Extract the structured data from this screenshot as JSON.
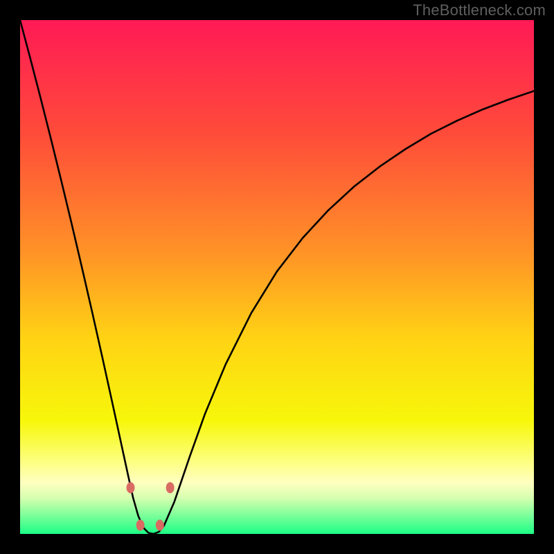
{
  "watermark": "TheBottleneck.com",
  "chart_data": {
    "type": "line",
    "title": "",
    "xlabel": "",
    "ylabel": "",
    "xlim": [
      0,
      100
    ],
    "ylim": [
      0,
      100
    ],
    "grid": false,
    "legend": false,
    "background": {
      "type": "vertical-gradient",
      "stops": [
        {
          "pct": 0,
          "color": "#ff1a55"
        },
        {
          "pct": 22,
          "color": "#ff4b3a"
        },
        {
          "pct": 45,
          "color": "#ff9227"
        },
        {
          "pct": 62,
          "color": "#ffd314"
        },
        {
          "pct": 78,
          "color": "#f7f70a"
        },
        {
          "pct": 86,
          "color": "#fdff82"
        },
        {
          "pct": 90,
          "color": "#ffffc0"
        },
        {
          "pct": 93,
          "color": "#d6ffb0"
        },
        {
          "pct": 96,
          "color": "#86ff9c"
        },
        {
          "pct": 100,
          "color": "#1cff86"
        }
      ]
    },
    "series": [
      {
        "name": "bottleneck-curve",
        "x": [
          0.0,
          2.0,
          4.0,
          6.0,
          8.0,
          10.0,
          12.0,
          14.0,
          16.0,
          18.0,
          19.0,
          20.0,
          21.0,
          22.0,
          23.0,
          24.0,
          25.0,
          26.0,
          27.0,
          28.0,
          30.0,
          33.0,
          36.0,
          40.0,
          45.0,
          50.0,
          55.0,
          60.0,
          65.0,
          70.0,
          75.0,
          80.0,
          85.0,
          90.0,
          95.0,
          100.0
        ],
        "values": [
          100.0,
          92.5,
          84.8,
          76.9,
          68.8,
          60.5,
          52.0,
          43.3,
          34.4,
          25.3,
          20.7,
          16.1,
          11.5,
          7.0,
          3.5,
          1.2,
          0.2,
          0.0,
          0.4,
          1.6,
          6.2,
          15.0,
          23.4,
          33.0,
          43.0,
          51.1,
          57.6,
          63.0,
          67.6,
          71.5,
          74.9,
          77.9,
          80.4,
          82.6,
          84.5,
          86.2
        ]
      }
    ],
    "markers": [
      {
        "x": 21.5,
        "y": 9.0
      },
      {
        "x": 23.4,
        "y": 1.7
      },
      {
        "x": 27.2,
        "y": 1.7
      },
      {
        "x": 29.2,
        "y": 9.0
      }
    ],
    "marker_style": {
      "color": "#d96b63",
      "rx": 6,
      "ry": 8
    }
  }
}
